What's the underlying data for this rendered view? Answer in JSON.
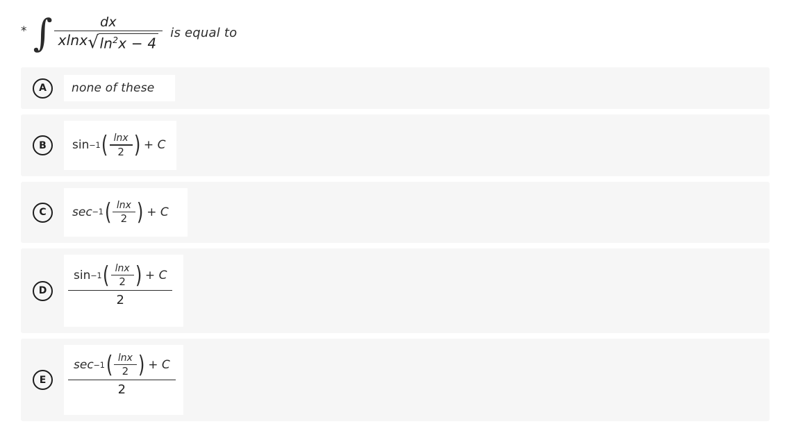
{
  "question": {
    "marker": "*",
    "integral_symbol": "∫",
    "numerator": "dx",
    "denominator_prefix": "xlnx",
    "radicand_base": "ln",
    "radicand_exponent": "2",
    "radicand_rest": "x − 4",
    "radical_symbol": "√",
    "trailing_text": "is equal to"
  },
  "options": [
    {
      "letter": "A",
      "kind": "text",
      "text": "none of these"
    },
    {
      "letter": "B",
      "kind": "simple",
      "function": "sin",
      "function_style": "upright",
      "inverse": "−1",
      "arg_numerator": "lnx",
      "arg_denominator": "2",
      "tail": "+ C",
      "tail_plus": "+",
      "tail_constant": "C"
    },
    {
      "letter": "C",
      "kind": "simple",
      "function": "sec",
      "function_style": "italic",
      "inverse": "−1",
      "arg_numerator": "lnx",
      "arg_denominator": "2",
      "tail_plus": "+",
      "tail_constant": "C"
    },
    {
      "letter": "D",
      "kind": "fraction",
      "function": "sin",
      "function_style": "upright",
      "inverse": "−1",
      "arg_numerator": "lnx",
      "arg_denominator": "2",
      "tail_plus": "+",
      "tail_constant": "C",
      "outer_denominator": "2"
    },
    {
      "letter": "E",
      "kind": "fraction",
      "function": "sec",
      "function_style": "italic",
      "inverse": "−1",
      "arg_numerator": "lnx",
      "arg_denominator": "2",
      "tail_plus": "+",
      "tail_constant": "C",
      "outer_denominator": "2"
    }
  ],
  "parens": {
    "open": "(",
    "close": ")"
  },
  "colors": {
    "page_background": "#ffffff",
    "row_background": "#f6f6f6",
    "answer_box_background": "#ffffff",
    "text": "#2b2b2b",
    "badge_border": "#1d1d1d"
  }
}
